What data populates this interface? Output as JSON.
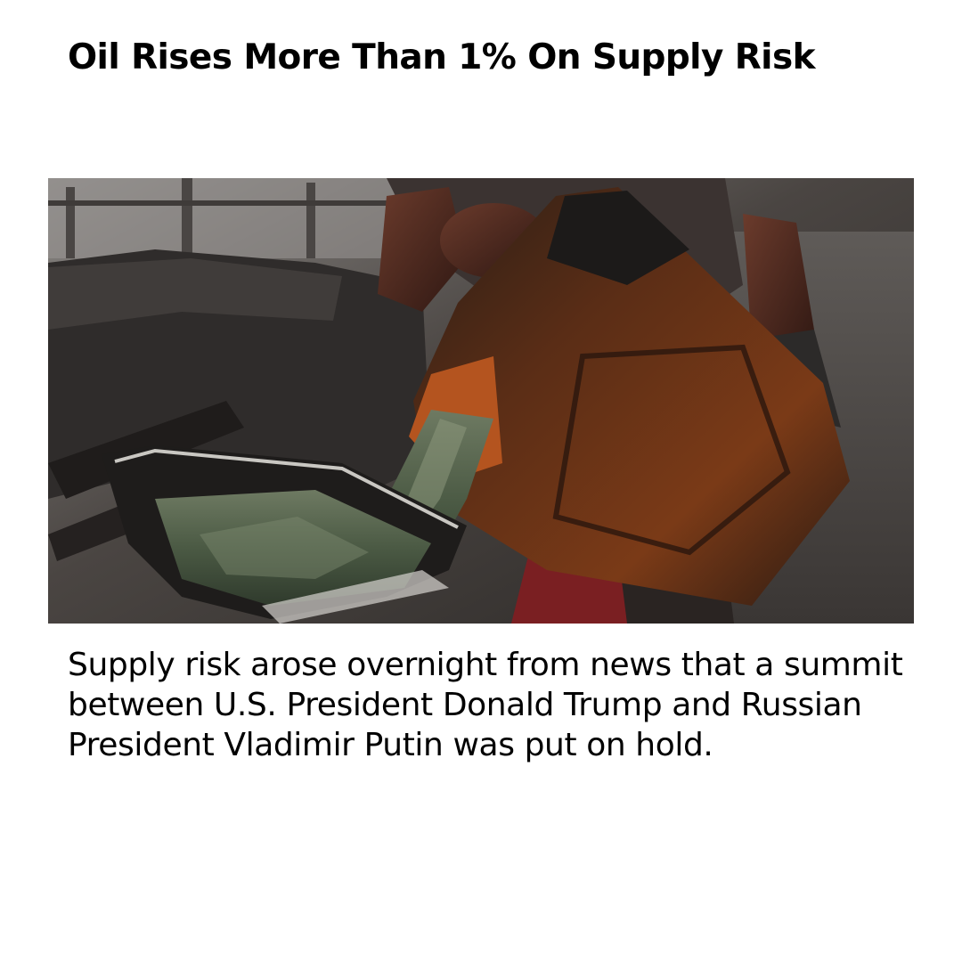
{
  "article": {
    "headline": "Oil Rises More Than 1% On Supply Risk",
    "body": "Supply risk arose overnight from news that a summit between U.S. President Donald Trump and Russian President Vladimir Putin was put on hold."
  },
  "photo": {
    "subject": "a worker pouring crude oil from a battered jerrycan into a metal pan"
  }
}
